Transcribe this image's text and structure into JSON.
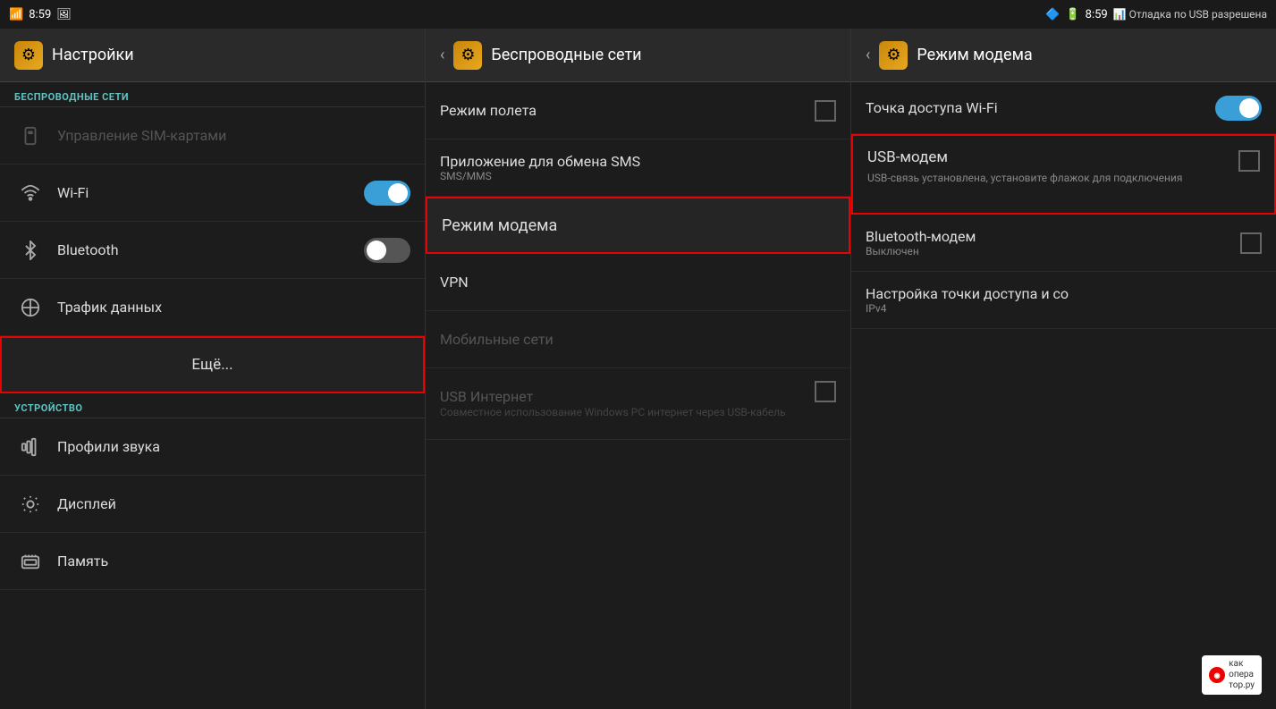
{
  "statusBar": {
    "left": {
      "wifi": "📶",
      "time": "8:59",
      "image": "🖼"
    },
    "right": {
      "bluetooth": "🔷",
      "battery": "🔋",
      "time": "8:59",
      "usb_debug": "📊 Отладка по USB разрешена"
    }
  },
  "panel1": {
    "title": "Настройки",
    "sections": {
      "wireless": {
        "label": "БЕСПРОВОДНЫЕ СЕТИ",
        "items": [
          {
            "id": "sim",
            "icon": "sim",
            "label": "Управление SIM-картами",
            "sublabel": "",
            "disabled": true
          },
          {
            "id": "wifi",
            "icon": "wifi",
            "label": "Wi-Fi",
            "sublabel": "",
            "toggle": "on"
          },
          {
            "id": "bluetooth",
            "icon": "bt",
            "label": "Bluetooth",
            "sublabel": "",
            "toggle": "off"
          },
          {
            "id": "traffic",
            "icon": "traffic",
            "label": "Трафик данных",
            "sublabel": ""
          },
          {
            "id": "more",
            "icon": "",
            "label": "Ещё...",
            "sublabel": "",
            "highlight": true
          }
        ]
      },
      "device": {
        "label": "УСТРОЙСТВО",
        "items": [
          {
            "id": "sound",
            "icon": "sound",
            "label": "Профили звука",
            "sublabel": ""
          },
          {
            "id": "display",
            "icon": "display",
            "label": "Дисплей",
            "sublabel": ""
          },
          {
            "id": "memory",
            "icon": "memory",
            "label": "Память",
            "sublabel": ""
          }
        ]
      }
    }
  },
  "panel2": {
    "title": "Беспроводные сети",
    "items": [
      {
        "id": "airplane",
        "label": "Режим полета",
        "sublabel": "",
        "checkbox": true,
        "checked": false,
        "disabled": false
      },
      {
        "id": "sms",
        "label": "Приложение для обмена SMS",
        "sublabel": "SMS/MMS",
        "disabled": false
      },
      {
        "id": "modem",
        "label": "Режим модема",
        "sublabel": "",
        "highlight": true,
        "disabled": false
      },
      {
        "id": "vpn",
        "label": "VPN",
        "sublabel": "",
        "disabled": false
      },
      {
        "id": "mobile",
        "label": "Мобильные сети",
        "sublabel": "",
        "disabled": true
      },
      {
        "id": "usb_internet",
        "label": "USB Интернет",
        "sublabel": "Совместное использование Windows PC интернет через USB-кабель",
        "checkbox": true,
        "checked": false,
        "disabled": true
      }
    ]
  },
  "panel3": {
    "title": "Режим модема",
    "items": [
      {
        "id": "wifi_ap",
        "label": "Точка доступа Wi-Fi",
        "sublabel": "",
        "toggle": "on"
      },
      {
        "id": "usb_modem",
        "label": "USB-модем",
        "sublabel": "USB-связь установлена, установите флажок для подключения",
        "checkbox": true,
        "checked": false,
        "highlight": true
      },
      {
        "id": "bt_modem",
        "label": "Bluetooth-модем",
        "sublabel": "Выключен",
        "checkbox": true,
        "checked": false
      },
      {
        "id": "hotspot_settings",
        "label": "Настройка точки доступа и со",
        "sublabel": "IPv4"
      }
    ]
  },
  "watermark": {
    "text": "как\nопера\nтор.ру"
  }
}
